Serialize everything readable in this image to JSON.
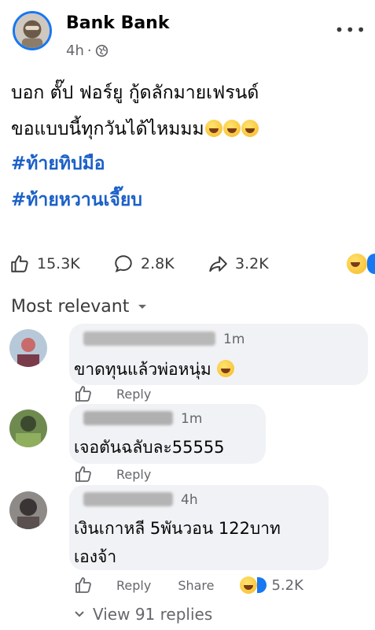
{
  "post": {
    "author": "Bank Bank",
    "time": "4h",
    "separator": "·",
    "line1": "บอก ตั๊ป ฟอร์ยู กู้ดลักมายเฟรนด์",
    "line2": "ขอแบบนี้ทุกวันได้ไหมมม",
    "hashtags": [
      "#ท้ายทิปมือ",
      "#ท้ายหวานเจี๊ยบ"
    ]
  },
  "stats": {
    "likes": "15.3K",
    "comments": "2.8K",
    "shares": "3.2K"
  },
  "sort_label": "Most relevant",
  "comments": [
    {
      "time": "1m",
      "text": "ขาดทุนแล้วพ่อหนุ่ม",
      "reply": "Reply"
    },
    {
      "time": "1m",
      "text": "เจอตันฉลับละ55555",
      "reply": "Reply"
    },
    {
      "time": "4h",
      "text_line1": "เงินเกาหลี 5พันวอน 122บาท",
      "text_line2": "เองจ้า",
      "reply": "Reply",
      "share": "Share",
      "reactions": "5.2K"
    }
  ],
  "view_replies": "View 91 replies",
  "colors": {
    "link_blue": "#1b60c8",
    "accent": "#1877f2",
    "muted": "#65676b"
  },
  "icons": [
    "globe-icon",
    "more-icon",
    "like-icon",
    "comment-icon",
    "share-icon",
    "haha-emoji-icon",
    "chevron-down-icon"
  ]
}
